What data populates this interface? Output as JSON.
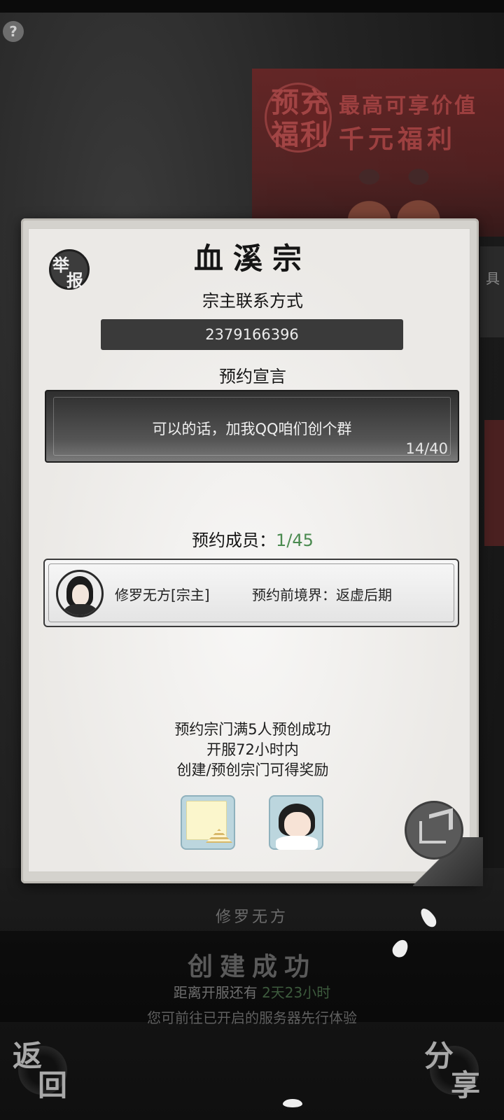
{
  "colors": {
    "accent_green": "#4a8a4f",
    "dialog_bg": "#eceae7",
    "dark_box": "#3a3a3a"
  },
  "background": {
    "promo": {
      "seal_line1": "预充",
      "seal_line2": "福利",
      "line1": "最高可享价值",
      "line2": "千元福利"
    },
    "side_tab_char": "具"
  },
  "dialog": {
    "report_button": {
      "char1": "举",
      "char2": "报",
      "icon": "report-seal-icon"
    },
    "sect_name": "血溪宗",
    "contact_label": "宗主联系方式",
    "contact_value": "2379166396",
    "declaration_label": "预约宣言",
    "declaration_text": "可以的话，加我QQ咱们创个群",
    "declaration_count": "14/40",
    "members_label": "预约成员：",
    "members_count": "1/45",
    "members": [
      {
        "name": "修罗无方[宗主]",
        "realm": "预约前境界：返虚后期",
        "avatar": "cultivator-avatar"
      }
    ],
    "rules": [
      "预约宗门满5人预创成功",
      "开服72小时内",
      "创建/预创宗门可得奖励"
    ],
    "rewards": [
      {
        "icon": "scroll-reward-icon"
      },
      {
        "icon": "character-reward-icon"
      }
    ],
    "share_icon": "share-icon"
  },
  "footer": {
    "creator_name": "修罗无方",
    "status_title": "创建成功",
    "countdown_prefix": "距离开服还有",
    "countdown_value": "2天23小时",
    "hint": "您可前往已开启的服务器先行体验",
    "back_button": {
      "char1": "返",
      "char2": "回"
    },
    "share_button": {
      "char1": "分",
      "char2": "享"
    }
  },
  "help_button": "?"
}
